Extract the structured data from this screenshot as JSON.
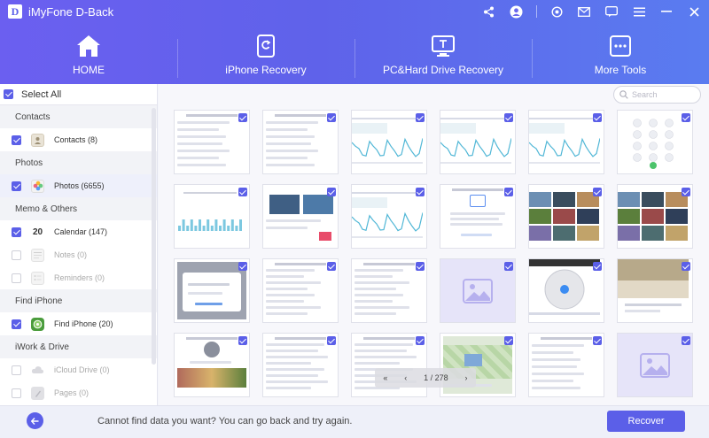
{
  "app": {
    "title": "iMyFone D-Back",
    "logo_letter": "D"
  },
  "titlebar_icons": [
    "share-icon",
    "account-icon",
    "settings-icon",
    "mail-icon",
    "feedback-icon",
    "menu-icon",
    "minimize-icon",
    "close-icon"
  ],
  "nav": {
    "tabs": [
      {
        "label": "HOME",
        "icon": "home-icon",
        "active": true
      },
      {
        "label": "iPhone Recovery",
        "icon": "iphone-recovery-icon"
      },
      {
        "label": "PC&Hard Drive Recovery",
        "icon": "pc-drive-recovery-icon"
      },
      {
        "label": "More Tools",
        "icon": "more-tools-icon"
      }
    ]
  },
  "sidebar": {
    "select_all_label": "Select All",
    "select_all_checked": true,
    "sections": [
      {
        "title": "Contacts",
        "items": [
          {
            "label": "Contacts (8)",
            "checked": true,
            "enabled": true,
            "icon": "contacts-icon"
          }
        ]
      },
      {
        "title": "Photos",
        "items": [
          {
            "label": "Photos (6655)",
            "checked": true,
            "enabled": true,
            "selected": true,
            "icon": "photos-icon"
          }
        ]
      },
      {
        "title": "Memo & Others",
        "items": [
          {
            "label": "Calendar (147)",
            "checked": true,
            "enabled": true,
            "icon": "calendar-icon",
            "icon_text": "20"
          },
          {
            "label": "Notes (0)",
            "checked": false,
            "enabled": false,
            "icon": "notes-icon"
          },
          {
            "label": "Reminders (0)",
            "checked": false,
            "enabled": false,
            "icon": "reminders-icon"
          }
        ]
      },
      {
        "title": "Find iPhone",
        "items": [
          {
            "label": "Find iPhone (20)",
            "checked": true,
            "enabled": true,
            "icon": "find-iphone-icon"
          }
        ]
      },
      {
        "title": "iWork & Drive",
        "items": [
          {
            "label": "iCloud Drive (0)",
            "checked": false,
            "enabled": false,
            "icon": "icloud-drive-icon"
          },
          {
            "label": "Pages (0)",
            "checked": false,
            "enabled": false,
            "icon": "pages-icon"
          }
        ]
      }
    ]
  },
  "search": {
    "placeholder": "Search"
  },
  "grid": {
    "thumbnails": [
      "settings-list",
      "settings-list",
      "stats-chart",
      "stats-chart",
      "stats-chart",
      "dialpad",
      "bar-stats",
      "video-app",
      "stats-chart",
      "dialog",
      "video-grid",
      "video-grid",
      "popup",
      "chat-list",
      "chat-list",
      "image-placeholder",
      "map-circle",
      "social-feed",
      "profile",
      "list",
      "list",
      "map-game",
      "settings-list",
      "image-placeholder"
    ],
    "checked": true
  },
  "pager": {
    "text": "1 / 278"
  },
  "footer": {
    "message": "Cannot find data you want? You can go back and try again.",
    "recover_label": "Recover"
  },
  "colors": {
    "accent": "#5b5fe8",
    "header_start": "#6b5ff0",
    "header_end": "#5a7cf0",
    "placeholder_bg": "#e6e4f9"
  }
}
